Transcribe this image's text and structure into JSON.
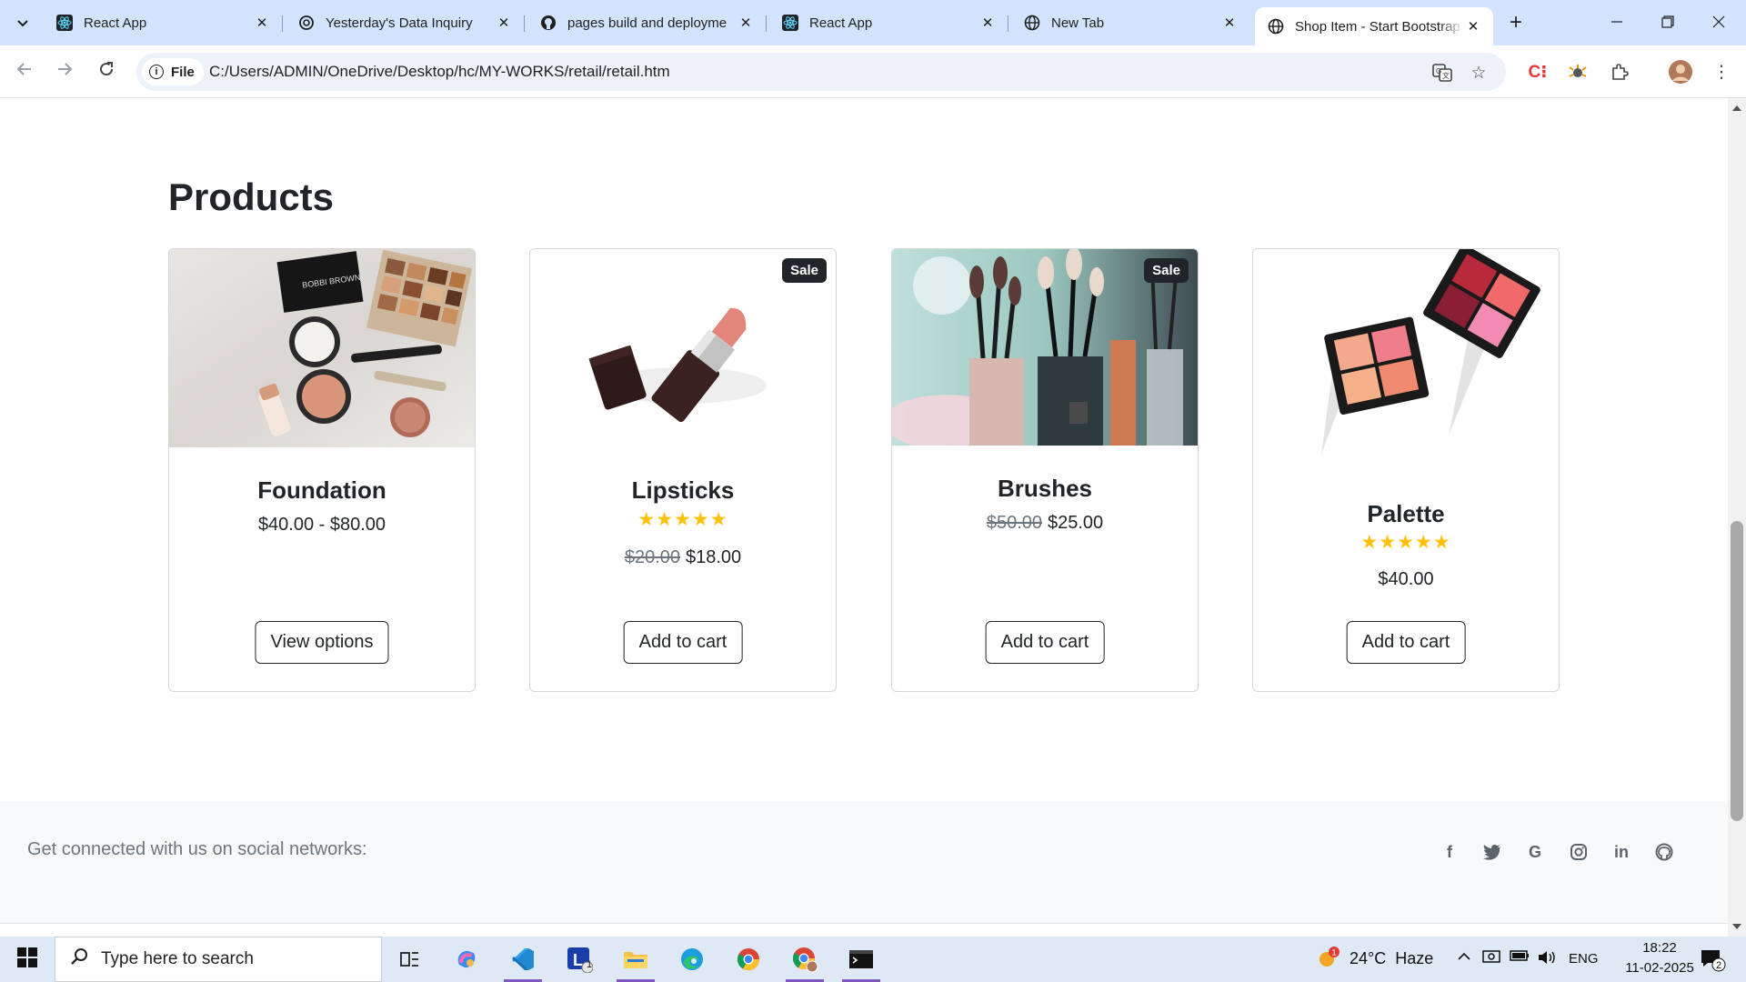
{
  "browser": {
    "tabs": [
      {
        "title": "React App",
        "favicon": "react-icon",
        "active": false
      },
      {
        "title": "Yesterday's Data Inquiry",
        "favicon": "openai-icon",
        "active": false
      },
      {
        "title": "pages build and deployme",
        "favicon": "github-icon",
        "active": false
      },
      {
        "title": "React App",
        "favicon": "react-icon",
        "active": false
      },
      {
        "title": "New Tab",
        "favicon": "globe-icon",
        "active": false
      },
      {
        "title": "Shop Item - Start Bootstrap",
        "favicon": "globe-icon",
        "active": true
      }
    ],
    "site_chip": "File",
    "url": "C:/Users/ADMIN/OneDrive/Desktop/hc/MY-WORKS/retail/retail.htm"
  },
  "page": {
    "heading": "Products",
    "products": [
      {
        "name": "Foundation",
        "price": "$40.00 - $80.00",
        "old_price": "",
        "sale_badge": "",
        "rating": 0,
        "button": "View options"
      },
      {
        "name": "Lipsticks",
        "price": "$18.00",
        "old_price": "$20.00",
        "sale_badge": "Sale",
        "rating": 5,
        "button": "Add to cart"
      },
      {
        "name": "Brushes",
        "price": "$25.00",
        "old_price": "$50.00",
        "sale_badge": "Sale",
        "rating": 0,
        "button": "Add to cart"
      },
      {
        "name": "Palette",
        "price": "$40.00",
        "old_price": "",
        "sale_badge": "",
        "rating": 5,
        "button": "Add to cart"
      }
    ],
    "stars_glyph": "★★★★★",
    "footer": {
      "text": "Get connected with us on social networks:",
      "social": [
        "facebook-icon",
        "twitter-icon",
        "google-icon",
        "instagram-icon",
        "linkedin-icon",
        "github-icon"
      ]
    }
  },
  "taskbar": {
    "search_placeholder": "Type here to search",
    "weather": "24°C  Haze",
    "weather_badge": "1",
    "language": "ENG",
    "time": "18:22",
    "date": "11-02-2025",
    "notifications": "2",
    "app_badge": "1"
  },
  "colors": {
    "accent_star": "#ffc107",
    "tabstrip": "#d3e3fd",
    "taskbar_underline": "#7e57c2"
  }
}
